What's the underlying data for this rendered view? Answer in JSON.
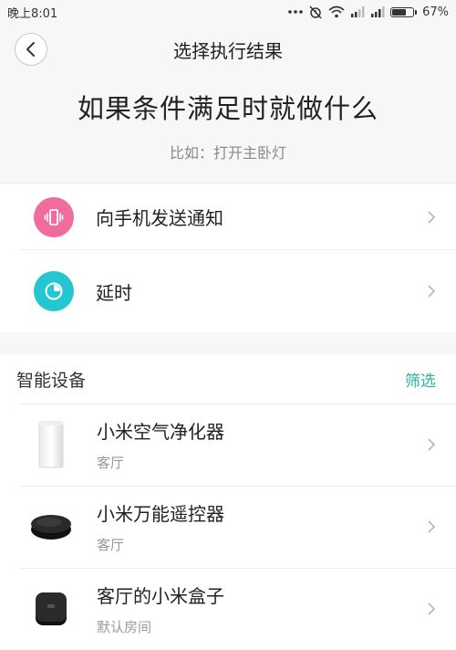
{
  "status_bar": {
    "time": "晚上8:01",
    "battery": "67%",
    "battery_level": 0.67,
    "icons": [
      "more-dots-icon",
      "alarm-off-icon",
      "wifi-icon",
      "signal-icon",
      "signal-icon",
      "battery-icon"
    ]
  },
  "nav": {
    "title": "选择执行结果",
    "back_icon": "back-chevron-icon"
  },
  "header": {
    "headline": "如果条件满足时就做什么",
    "hint": "比如：打开主卧灯"
  },
  "actions": [
    {
      "label": "向手机发送通知",
      "icon": "phone-vibrate-icon",
      "color": "#ef6d9c"
    },
    {
      "label": "延时",
      "icon": "timer-icon",
      "color": "#24c6d2"
    }
  ],
  "devices_section": {
    "title": "智能设备",
    "filter_label": "筛选",
    "accent": "#2ab3a3",
    "items": [
      {
        "name": "小米空气净化器",
        "room": "客厅",
        "thumb": "air-purifier-image"
      },
      {
        "name": "小米万能遥控器",
        "room": "客厅",
        "thumb": "universal-remote-image"
      },
      {
        "name": "客厅的小米盒子",
        "room": "默认房间",
        "thumb": "mi-box-image"
      }
    ]
  }
}
